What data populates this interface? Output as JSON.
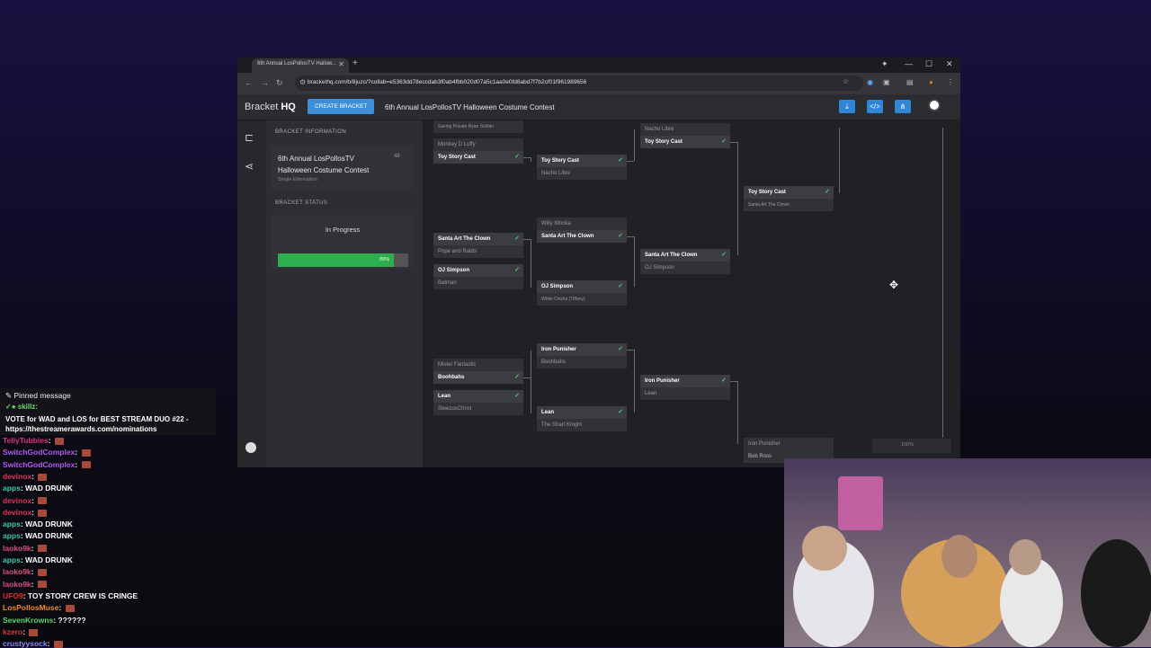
{
  "browser": {
    "tab_title": "6th Annual LosPollosTV Hallow...",
    "url": "brackethq.com/b/8juzc/?collab=e5363dd78eccdab3f0ab4fbb020d07a5c1aa0e0fd8abd7f7b2cf01f961989656"
  },
  "app": {
    "logo_light": "Bracket",
    "logo_bold": "HQ",
    "create_button": "CREATE BRACKET",
    "bracket_title": "6th Annual LosPollosTV Halloween Costume Contest"
  },
  "sidebar": {
    "info_label": "BRACKET INFORMATION",
    "bracket_name": "6th Annual LosPollosTV Halloween Costume Contest",
    "bracket_type": "Single Elimination",
    "entrant_count": "48",
    "status_label": "BRACKET STATUS",
    "status": "In Progress",
    "progress_percent": 89,
    "progress_label": "89%"
  },
  "bracket": {
    "round1": {
      "m0": {
        "top": "Saving Private Ryan Soldier"
      },
      "m1": {
        "top": "Monkey D Luffy",
        "bottom": "Toy Story Cast"
      },
      "m2": {
        "top": "Santa Art The Clown",
        "bottom": "Pope and Rabbi"
      },
      "m3": {
        "top": "OJ Simpson",
        "bottom": "Batman"
      },
      "m4": {
        "top": "Mister Fantastic",
        "bottom": "Boohbahs"
      },
      "m5": {
        "top": "Lean",
        "bottom": "SteezusChrist"
      }
    },
    "round2": {
      "m1": {
        "top": "Toy Story Cast",
        "bottom": "Nacho Libre"
      },
      "m2": {
        "top": "Willy Wonka",
        "bottom": "Santa Art The Clown"
      },
      "m3": {
        "top": "OJ Simpson",
        "bottom": "White Chicks (Tiffany)"
      },
      "m4": {
        "top": "Iron Punisher",
        "bottom": "Boohbahs"
      },
      "m5": {
        "top": "Lean",
        "bottom": "The Shart Knight"
      }
    },
    "round3": {
      "m1": {
        "top": "Nacho Libre",
        "bottom": "Toy Story Cast"
      },
      "m2": {
        "top": "Santa Art The Clown",
        "bottom": "OJ Simpson"
      },
      "m3": {
        "top": "Iron Punisher",
        "bottom": "Lean"
      }
    },
    "round4": {
      "m1": {
        "top": "Toy Story Cast",
        "bottom": "Santa Art The Clown"
      },
      "m2": {
        "top": "Iron Punisher",
        "bottom": "Bob Ross"
      }
    },
    "zoom": "100%"
  },
  "chat": {
    "pinned_header": "Pinned message",
    "pinned_user": "skillz",
    "pinned_text": "VOTE for WAD and LOS for BEST STREAM DUO #22 - https://thestreamerawards.com/nominations",
    "messages": [
      {
        "user": "TellyTubbies",
        "text": "",
        "color": "#d6357a"
      },
      {
        "user": "SwitchGodComplex",
        "text": "",
        "color": "#b05cf0"
      },
      {
        "user": "SwitchGodComplex",
        "text": "",
        "color": "#b05cf0"
      },
      {
        "user": "devinox",
        "text": "",
        "color": "#e0315a"
      },
      {
        "user": "apps",
        "text": "WAD DRUNK",
        "color": "#37c7a8"
      },
      {
        "user": "devinox",
        "text": "",
        "color": "#e0315a"
      },
      {
        "user": "devinox",
        "text": "",
        "color": "#e0315a"
      },
      {
        "user": "apps",
        "text": "WAD DRUNK",
        "color": "#37c7a8"
      },
      {
        "user": "apps",
        "text": "WAD DRUNK",
        "color": "#37c7a8"
      },
      {
        "user": "laoko9k",
        "text": "",
        "color": "#d9517a"
      },
      {
        "user": "apps",
        "text": "WAD DRUNK",
        "color": "#37c7a8"
      },
      {
        "user": "laoko9k",
        "text": "",
        "color": "#d9517a"
      },
      {
        "user": "laoko9k",
        "text": "",
        "color": "#d9517a"
      },
      {
        "user": "UFO9",
        "text": "TOY STORY CREW IS CRINGE",
        "color": "#e03030"
      },
      {
        "user": "LosPollosMuse",
        "text": "",
        "color": "#f08a30"
      },
      {
        "user": "SevenKrowns",
        "text": "??????",
        "color": "#5ad66a"
      },
      {
        "user": "kzero",
        "text": "",
        "color": "#d63a3a"
      },
      {
        "user": "crustyysock",
        "text": "",
        "color": "#8a8aff"
      }
    ]
  }
}
